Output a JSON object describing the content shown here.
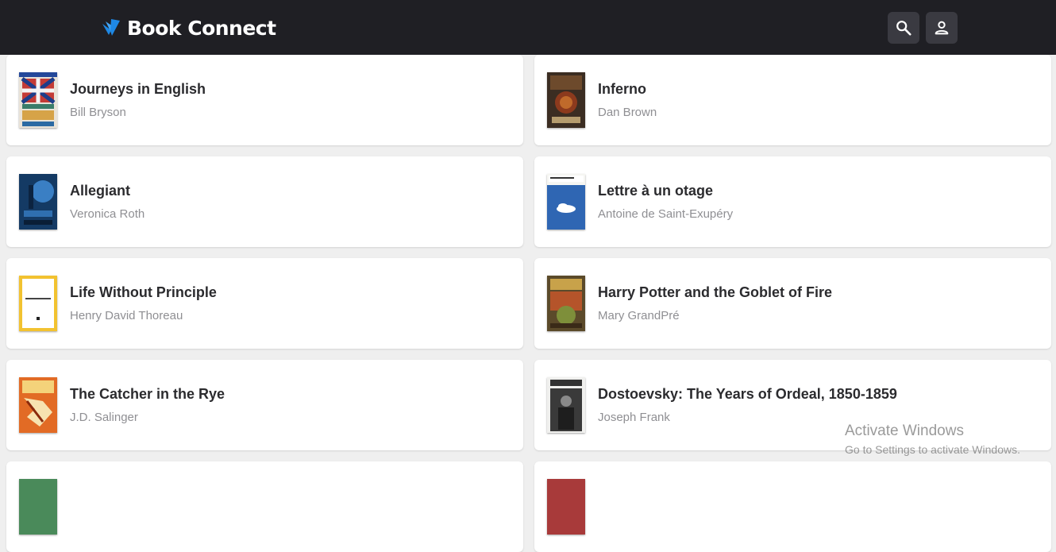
{
  "app": {
    "title": "Book Connect"
  },
  "header": {
    "search_icon": "search-icon",
    "user_icon": "person-icon"
  },
  "books": [
    {
      "title": "Journeys in English",
      "author": "Bill Bryson"
    },
    {
      "title": "Inferno",
      "author": "Dan Brown"
    },
    {
      "title": "Allegiant",
      "author": "Veronica Roth"
    },
    {
      "title": "Lettre à un otage",
      "author": "Antoine de Saint-Exupéry"
    },
    {
      "title": "Life Without Principle",
      "author": "Henry David Thoreau"
    },
    {
      "title": "Harry Potter and the Goblet of Fire",
      "author": "Mary GrandPré"
    },
    {
      "title": "The Catcher in the Rye",
      "author": "J.D. Salinger"
    },
    {
      "title": "Dostoevsky: The Years of Ordeal, 1850-1859",
      "author": "Joseph Frank"
    }
  ],
  "watermark": {
    "title": "Activate Windows",
    "subtitle": "Go to Settings to activate Windows."
  },
  "colors": {
    "header_bg": "#1f1f24",
    "page_bg": "#efefef",
    "accent": "#1e88e5"
  }
}
